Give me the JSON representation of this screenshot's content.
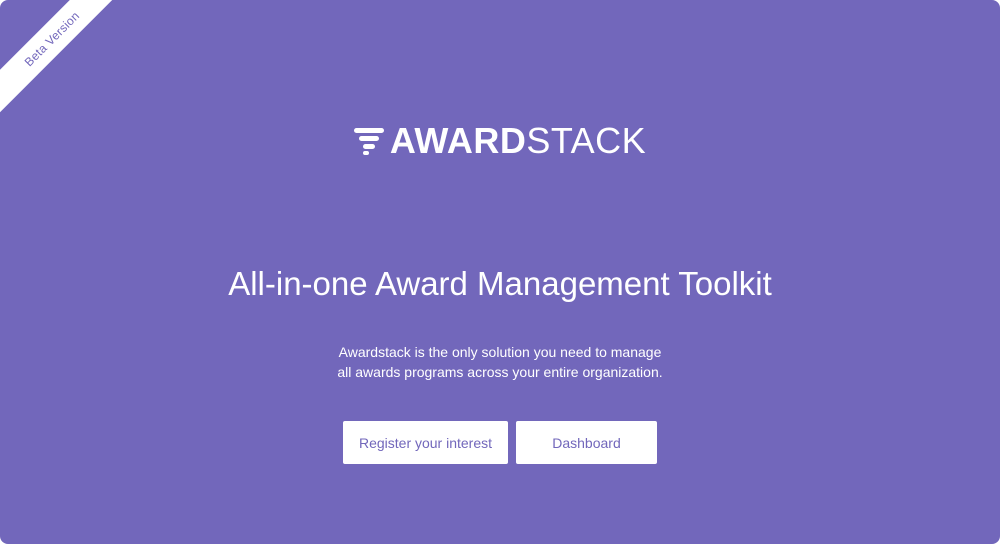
{
  "ribbon": {
    "label": "Beta Version"
  },
  "logo": {
    "bold": "AWARD",
    "light": "STACK",
    "icon": "award-stack-logo-icon"
  },
  "hero": {
    "headline": "All-in-one Award Management Toolkit",
    "subtext_line1": "Awardstack is the only solution you need to manage",
    "subtext_line2": "all awards programs across your entire organization."
  },
  "actions": {
    "register_label": "Register your interest",
    "dashboard_label": "Dashboard"
  },
  "colors": {
    "background": "#7267bb",
    "text": "#ffffff",
    "button_bg": "#ffffff",
    "button_text": "#7267bb"
  }
}
